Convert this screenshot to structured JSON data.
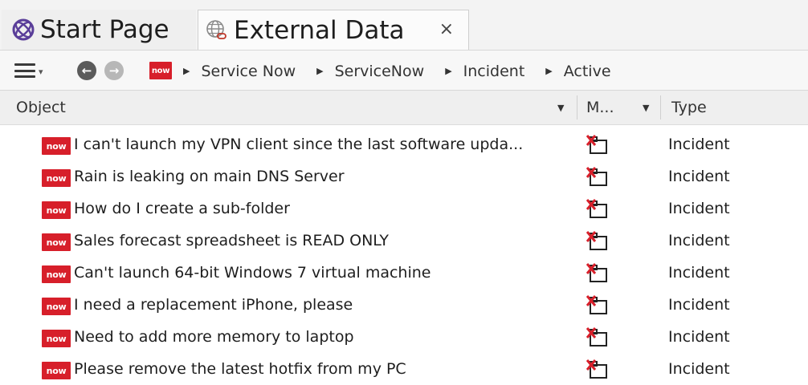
{
  "tabs": {
    "start_page": {
      "label": "Start Page",
      "icon": "start-page-icon",
      "color": "#5a3e99"
    },
    "external_data": {
      "label": "External Data",
      "icon": "external-data-icon",
      "close_label": "×"
    }
  },
  "toolbar": {
    "menu_icon": "hamburger-menu-icon",
    "back_icon": "back-arrow-icon",
    "forward_icon": "forward-arrow-icon",
    "provider_badge": "now",
    "breadcrumbs": [
      "Service Now",
      "ServiceNow",
      "Incident",
      "Active"
    ]
  },
  "columns": {
    "object": "Object",
    "modified": "M...",
    "type": "Type"
  },
  "badge_color": "#d71f2a",
  "rows": [
    {
      "badge": "now",
      "title": "I can't launch my VPN client since the last software upda...",
      "type": "Incident"
    },
    {
      "badge": "now",
      "title": "Rain is leaking on main DNS Server",
      "type": "Incident"
    },
    {
      "badge": "now",
      "title": "How do I create a sub-folder",
      "type": "Incident"
    },
    {
      "badge": "now",
      "title": "Sales forecast spreadsheet is READ ONLY",
      "type": "Incident"
    },
    {
      "badge": "now",
      "title": "Can't launch 64-bit Windows 7 virtual machine",
      "type": "Incident"
    },
    {
      "badge": "now",
      "title": "I need a replacement iPhone, please",
      "type": "Incident"
    },
    {
      "badge": "now",
      "title": "Need to add more memory to laptop",
      "type": "Incident"
    },
    {
      "badge": "now",
      "title": "Please remove the latest hotfix from my PC",
      "type": "Incident"
    }
  ]
}
